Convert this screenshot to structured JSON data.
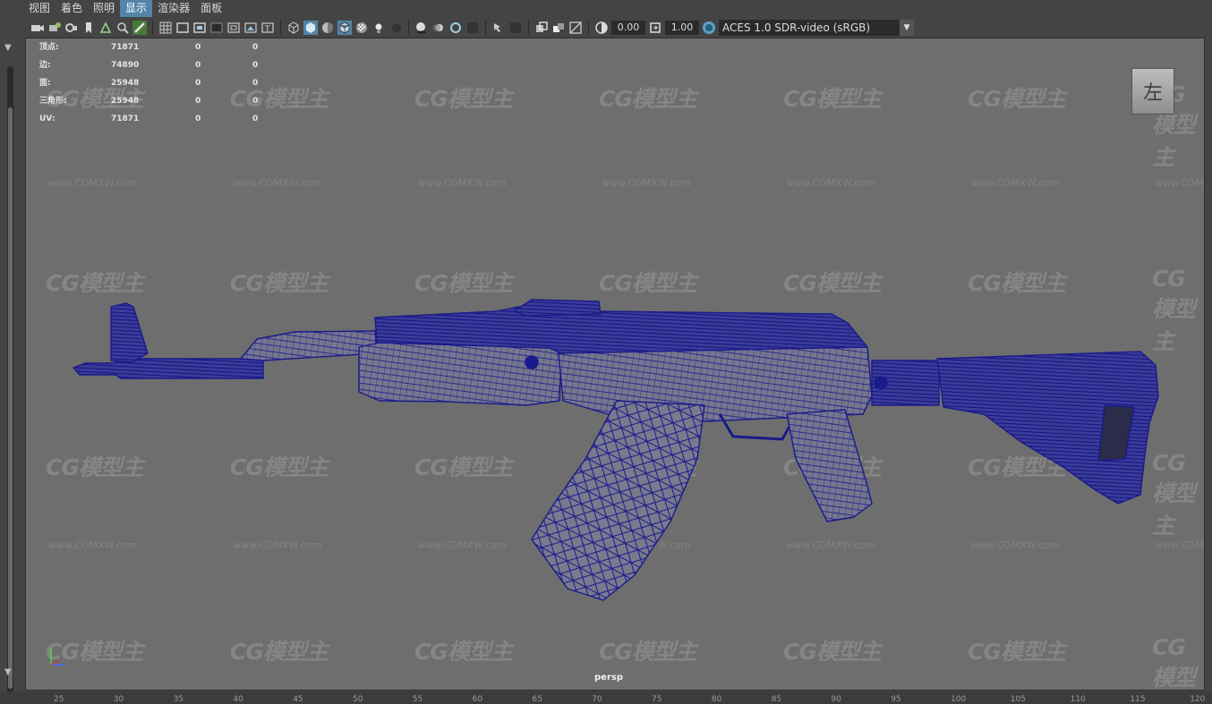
{
  "menubar": {
    "items": [
      {
        "label": "视图",
        "active": false
      },
      {
        "label": "着色",
        "active": false
      },
      {
        "label": "照明",
        "active": false
      },
      {
        "label": "显示",
        "active": true
      },
      {
        "label": "渲染器",
        "active": false
      },
      {
        "label": "面板",
        "active": false
      }
    ]
  },
  "toolbar": {
    "exposure_value": "0.00",
    "gamma_value": "1.00",
    "color_management": "ACES 1.0 SDR-video (sRGB)"
  },
  "stats": {
    "rows": [
      {
        "label": "顶点:",
        "v1": "71871",
        "v2": "0",
        "v3": "0"
      },
      {
        "label": "边:",
        "v1": "74890",
        "v2": "0",
        "v3": "0"
      },
      {
        "label": "面:",
        "v1": "25948",
        "v2": "0",
        "v3": "0"
      },
      {
        "label": "三角形:",
        "v1": "25948",
        "v2": "0",
        "v3": "0"
      },
      {
        "label": "UV:",
        "v1": "71871",
        "v2": "0",
        "v3": "0"
      }
    ]
  },
  "view_cube_label": "左",
  "camera_label": "persp",
  "watermark": {
    "logo": "CG模型主",
    "url": "www.CGMXW.com"
  },
  "ruler": {
    "ticks": [
      "25",
      "30",
      "35",
      "40",
      "45",
      "50",
      "55",
      "60",
      "65",
      "70",
      "75",
      "80",
      "85",
      "90",
      "95",
      "100",
      "105",
      "110",
      "115",
      "120"
    ]
  },
  "colors": {
    "wireframe": "#1a1a8c",
    "viewport_bg": "#6e6e6e",
    "active_menu": "#5285a6"
  }
}
